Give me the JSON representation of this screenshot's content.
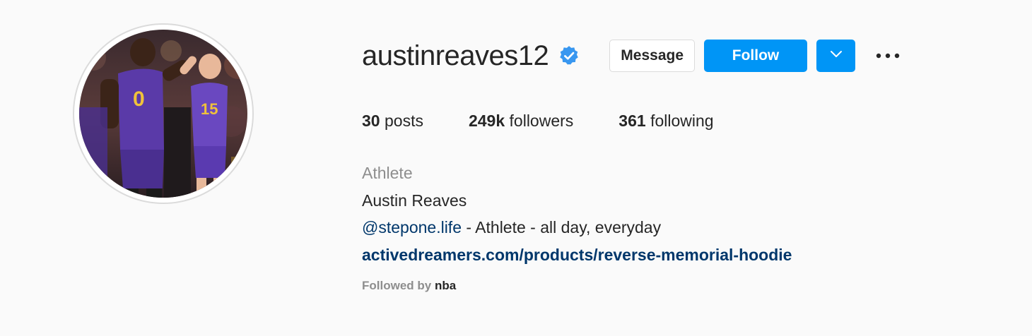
{
  "profile": {
    "username": "austinreaves12",
    "verified": true,
    "avatar_alt": "Profile photo",
    "buttons": {
      "message_label": "Message",
      "follow_label": "Follow"
    },
    "stats": {
      "posts_count": "30",
      "posts_label": "posts",
      "followers_count": "249k",
      "followers_label": "followers",
      "following_count": "361",
      "following_label": "following"
    },
    "bio": {
      "category": "Athlete",
      "full_name": "Austin Reaves",
      "mention": "@stepone.life",
      "text": " - Athlete - all day, everyday",
      "link": "activedreamers.com/products/reverse-memorial-hoodie"
    },
    "followed_by": {
      "prefix": "Followed by ",
      "name": "nba"
    }
  },
  "colors": {
    "background": "#fafafa",
    "primary_blue": "#0095f6",
    "link_blue": "#00376b",
    "verified_blue": "#3897f0",
    "muted_text": "#8e8e8e",
    "text": "#262626"
  },
  "icons": {
    "verified": "verified-badge-icon",
    "dropdown": "chevron-down-icon",
    "more": "more-options-icon"
  }
}
